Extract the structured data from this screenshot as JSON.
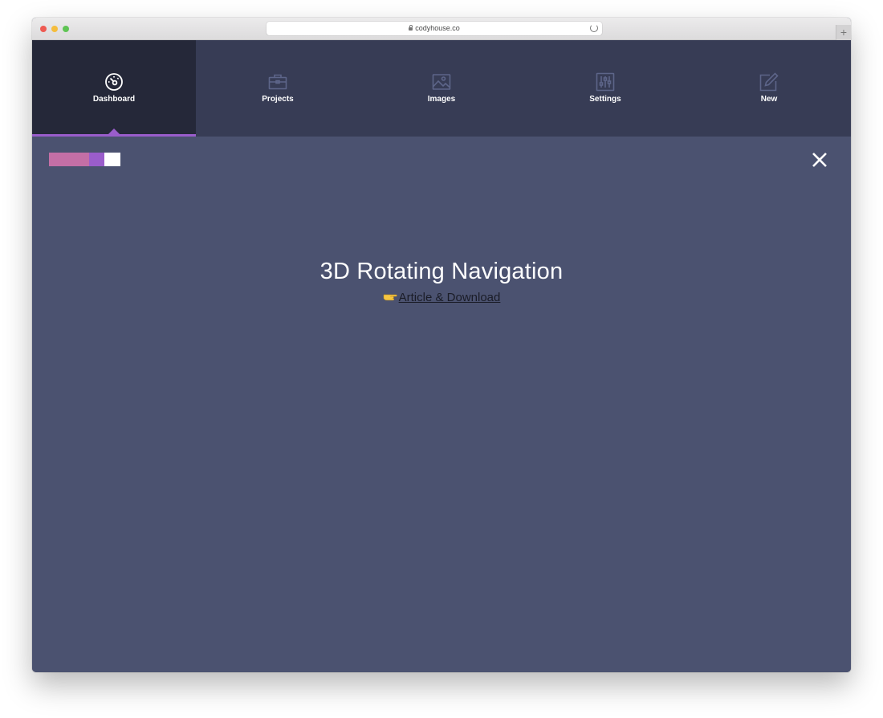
{
  "browser": {
    "url": "codyhouse.co",
    "newtab_label": "+"
  },
  "nav": {
    "items": [
      {
        "label": "Dashboard",
        "icon": "dashboard-gauge-icon",
        "active": true
      },
      {
        "label": "Projects",
        "icon": "briefcase-icon",
        "active": false
      },
      {
        "label": "Images",
        "icon": "image-icon",
        "active": false
      },
      {
        "label": "Settings",
        "icon": "sliders-icon",
        "active": false
      },
      {
        "label": "New",
        "icon": "edit-pencil-icon",
        "active": false
      }
    ]
  },
  "content": {
    "title": "3D Rotating Navigation",
    "link_label": "Article & Download",
    "link_icon": "pointing-hand-icon",
    "close_icon": "close-icon"
  },
  "colors": {
    "nav_bg": "#373c55",
    "nav_active_bg": "#252839",
    "accent": "#9a5dcb",
    "content_bg": "#4b5270",
    "logo_pink": "#c46fa6",
    "logo_purple": "#9a5dcb",
    "logo_white": "#ffffff"
  }
}
